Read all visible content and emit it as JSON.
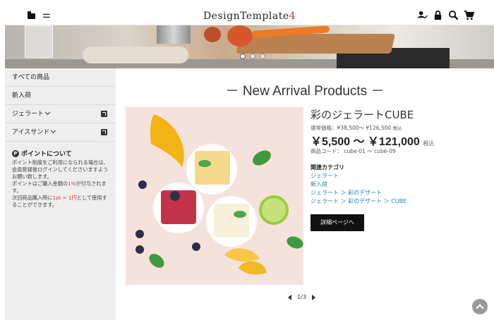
{
  "header": {
    "logo_main": "DesignTemplate",
    "logo_num": "4"
  },
  "hero": {
    "slide_count": 3,
    "active_slide": 1
  },
  "sidebar": {
    "items": [
      {
        "label": "すべての商品"
      },
      {
        "label": "新入荷"
      },
      {
        "label": "ジェラート"
      },
      {
        "label": "アイスサンド"
      }
    ],
    "point": {
      "title": "ポイントについて",
      "line1": "ポイント制度をご利用になられる場合は、会員登録後ログインしてくださいますようお願い致します。",
      "line2_pre": "ポイントはご購入金額の",
      "line2_rate": "1%",
      "line2_post": "が付与されます。",
      "line3_pre": "次回商品購入時に",
      "line3_rate": "1pt = 1円",
      "line3_post": "として使用することができます。"
    }
  },
  "main": {
    "title": "－ New Arrival Products －",
    "product": {
      "name": "彩のジェラートCUBE",
      "normal_price": "通常価格：¥38,500～ ¥126,500",
      "normal_tax": "税込",
      "price": "￥5,500 ～ ￥121,000",
      "price_tax": "税込",
      "code": "商品コード： cube-01 ～ cube-09",
      "category_head": "関連カテゴリ",
      "categories": [
        "ジェラート",
        "新入荷",
        "ジェラート ＞ 彩のデザート",
        "ジェラート ＞ 彩のデザート ＞ CUBE"
      ],
      "detail_button": "詳細ページへ"
    },
    "pager": "1/3"
  }
}
